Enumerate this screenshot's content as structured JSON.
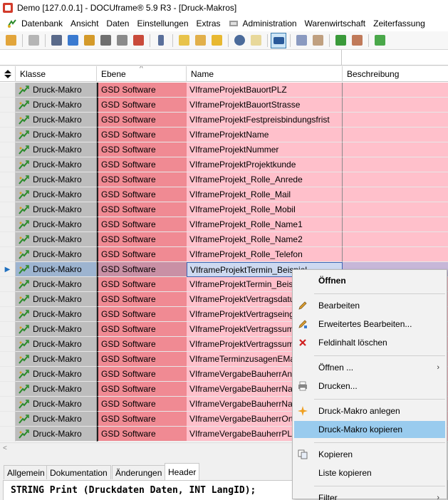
{
  "window": {
    "title": "Demo [127.0.0.1] - DOCUframe® 5.9 R3 - [Druck-Makros]"
  },
  "menu": [
    {
      "label": "Datenbank",
      "icon": "datenbank-icon"
    },
    {
      "label": "Ansicht",
      "icon": ""
    },
    {
      "label": "Daten",
      "icon": ""
    },
    {
      "label": "Einstellungen",
      "icon": ""
    },
    {
      "label": "Extras",
      "icon": ""
    },
    {
      "label": "Administration",
      "icon": "administration-icon"
    },
    {
      "label": "Warenwirtschaft",
      "icon": ""
    },
    {
      "label": "Zeiterfassung",
      "icon": ""
    }
  ],
  "colors": {
    "ebene": "#f08a93",
    "name": "#ffc0cb",
    "klasse": "#bdbdbd",
    "highlight": "#99cbee"
  },
  "grid": {
    "columns": [
      "Klasse",
      "Ebene",
      "Name",
      "Beschreibung"
    ],
    "selected_row": 12,
    "rows": [
      {
        "klasse": "Druck-Makro",
        "ebene": "GSD Software",
        "name": "VIframeProjektBauortPLZ",
        "beschreibung": ""
      },
      {
        "klasse": "Druck-Makro",
        "ebene": "GSD Software",
        "name": "VIframeProjektBauortStrasse",
        "beschreibung": ""
      },
      {
        "klasse": "Druck-Makro",
        "ebene": "GSD Software",
        "name": "VIframeProjektFestpreisbindungsfrist",
        "beschreibung": ""
      },
      {
        "klasse": "Druck-Makro",
        "ebene": "GSD Software",
        "name": "VIframeProjektName",
        "beschreibung": ""
      },
      {
        "klasse": "Druck-Makro",
        "ebene": "GSD Software",
        "name": "VIframeProjektNummer",
        "beschreibung": ""
      },
      {
        "klasse": "Druck-Makro",
        "ebene": "GSD Software",
        "name": "VIframeProjektProjektkunde",
        "beschreibung": ""
      },
      {
        "klasse": "Druck-Makro",
        "ebene": "GSD Software",
        "name": "VIframeProjekt_Rolle_Anrede",
        "beschreibung": ""
      },
      {
        "klasse": "Druck-Makro",
        "ebene": "GSD Software",
        "name": "VIframeProjekt_Rolle_Mail",
        "beschreibung": ""
      },
      {
        "klasse": "Druck-Makro",
        "ebene": "GSD Software",
        "name": "VIframeProjekt_Rolle_Mobil",
        "beschreibung": ""
      },
      {
        "klasse": "Druck-Makro",
        "ebene": "GSD Software",
        "name": "VIframeProjekt_Rolle_Name1",
        "beschreibung": ""
      },
      {
        "klasse": "Druck-Makro",
        "ebene": "GSD Software",
        "name": "VIframeProjekt_Rolle_Name2",
        "beschreibung": ""
      },
      {
        "klasse": "Druck-Makro",
        "ebene": "GSD Software",
        "name": "VIframeProjekt_Rolle_Telefon",
        "beschreibung": ""
      },
      {
        "klasse": "Druck-Makro",
        "ebene": "GSD Software",
        "name": "VIframeProjektTermin_Beispiel",
        "beschreibung": ""
      },
      {
        "klasse": "Druck-Makro",
        "ebene": "GSD Software",
        "name": "VIframeProjektTermin_Beis",
        "beschreibung": ""
      },
      {
        "klasse": "Druck-Makro",
        "ebene": "GSD Software",
        "name": "VIframeProjektVertragsdatu",
        "beschreibung": ""
      },
      {
        "klasse": "Druck-Makro",
        "ebene": "GSD Software",
        "name": "VIframeProjektVertragseing",
        "beschreibung": ""
      },
      {
        "klasse": "Druck-Makro",
        "ebene": "GSD Software",
        "name": "VIframeProjektVertragssum",
        "beschreibung": ""
      },
      {
        "klasse": "Druck-Makro",
        "ebene": "GSD Software",
        "name": "VIframeProjektVertragssum",
        "beschreibung": ""
      },
      {
        "klasse": "Druck-Makro",
        "ebene": "GSD Software",
        "name": "VIframeTerminzusagenEMa",
        "beschreibung": ""
      },
      {
        "klasse": "Druck-Makro",
        "ebene": "GSD Software",
        "name": "VIframeVergabeBauherrAnr",
        "beschreibung": ""
      },
      {
        "klasse": "Druck-Makro",
        "ebene": "GSD Software",
        "name": "VIframeVergabeBauherrNar",
        "beschreibung": ""
      },
      {
        "klasse": "Druck-Makro",
        "ebene": "GSD Software",
        "name": "VIframeVergabeBauherrNar",
        "beschreibung": ""
      },
      {
        "klasse": "Druck-Makro",
        "ebene": "GSD Software",
        "name": "VIframeVergabeBauherrOrt",
        "beschreibung": ""
      },
      {
        "klasse": "Druck-Makro",
        "ebene": "GSD Software",
        "name": "VIframeVergabeBauherrPLZ",
        "beschreibung": ""
      }
    ]
  },
  "tabs": [
    {
      "label": "Allgemein",
      "active": false
    },
    {
      "label": "Dokumentation",
      "active": false
    },
    {
      "label": "Änderungen",
      "active": false
    },
    {
      "label": "Header",
      "active": true
    }
  ],
  "code": {
    "text": "STRING Print (Druckdaten Daten, INT LangID);"
  },
  "context_menu": {
    "items": [
      {
        "label": "Öffnen",
        "icon": "",
        "bold": true
      },
      {
        "sep": true
      },
      {
        "label": "Bearbeiten",
        "icon": "pencil-icon"
      },
      {
        "label": "Erweitertes Bearbeiten...",
        "icon": "pencil-plus-icon"
      },
      {
        "label": "Feldinhalt löschen",
        "icon": "clear-field-icon"
      },
      {
        "sep": true
      },
      {
        "label": "Öffnen ...",
        "icon": "",
        "submenu": true
      },
      {
        "label": "Drucken...",
        "icon": "printer-icon"
      },
      {
        "sep": true
      },
      {
        "label": "Druck-Makro anlegen",
        "icon": "sparkle-icon"
      },
      {
        "label": "Druck-Makro kopieren",
        "icon": "",
        "highlighted": true
      },
      {
        "sep": true
      },
      {
        "label": "Kopieren",
        "icon": "copy-icon"
      },
      {
        "label": "Liste kopieren",
        "icon": ""
      },
      {
        "sep": true
      },
      {
        "label": "Filter",
        "icon": "",
        "submenu": true
      }
    ]
  },
  "toolbar_icons": [
    "folder-key-icon",
    "printer-icon",
    "id-card-icon",
    "list-icon",
    "package-icon",
    "tag-icon",
    "document-edit-icon",
    "calendar-icon",
    "phone-icon",
    "new-document-icon",
    "folder-open-icon",
    "folder-arrow-icon",
    "search-icon",
    "search-document-icon",
    "grid-view-icon",
    "tools-icon",
    "tools-alt-icon",
    "wand-icon",
    "wand-alt-icon",
    "wand-green-icon"
  ]
}
